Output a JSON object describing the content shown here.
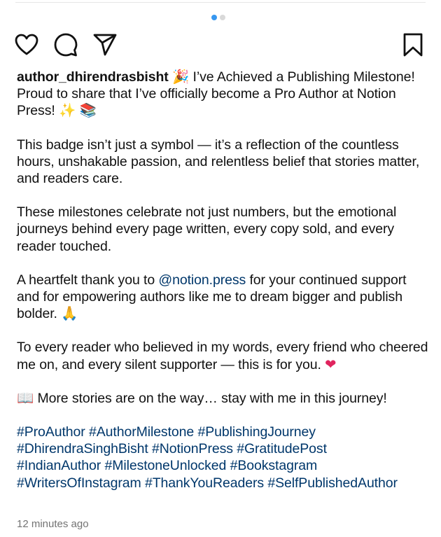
{
  "carousel": {
    "total": 2,
    "active_index": 0
  },
  "actions": {
    "like_icon": "heart-outline",
    "comment_icon": "speech-bubble",
    "share_icon": "paper-plane",
    "save_icon": "bookmark-outline"
  },
  "caption": {
    "username": "author_dhirendrasbisht",
    "emoji_party": "🎉",
    "line1_text": "I’ve Achieved a Publishing Milestone!",
    "line2_text": "Proud to share that I’ve officially become a Pro Author at Notion Press!",
    "emoji_sparkles": "✨",
    "emoji_books": "📚",
    "para2": "This badge isn’t just a symbol — it’s a reflection of the countless hours, unshakable passion, and relentless belief that stories matter, and readers care.",
    "para3": "These milestones celebrate not just numbers, but the emotional journeys behind every page written, every copy sold, and every reader touched.",
    "para4_before": "A heartfelt thank you to",
    "mention": "@notion.press",
    "para4_after": "for your continued support and for empowering authors like me to dream bigger and publish bolder.",
    "emoji_pray": "🙏",
    "para5": "To every reader who believed in my words, every friend who cheered me on, and every silent supporter — this is for you.",
    "emoji_heart": "❤",
    "emoji_open_book": "📖",
    "para6": "More stories are on the way… stay with me in this journey!",
    "hashtags": [
      "#ProAuthor",
      "#AuthorMilestone",
      "#PublishingJourney",
      "#DhirendraSinghBisht",
      "#NotionPress",
      "#GratitudePost",
      "#IndianAuthor",
      "#MilestoneUnlocked",
      "#Bookstagram",
      "#WritersOfInstagram",
      "#ThankYouReaders",
      "#SelfPublishedAuthor"
    ]
  },
  "timestamp": "12 minutes ago",
  "colors": {
    "link": "#00376b",
    "dot_active": "#3797f0",
    "dot_inactive": "#d9d9d9",
    "meta": "#737373"
  }
}
